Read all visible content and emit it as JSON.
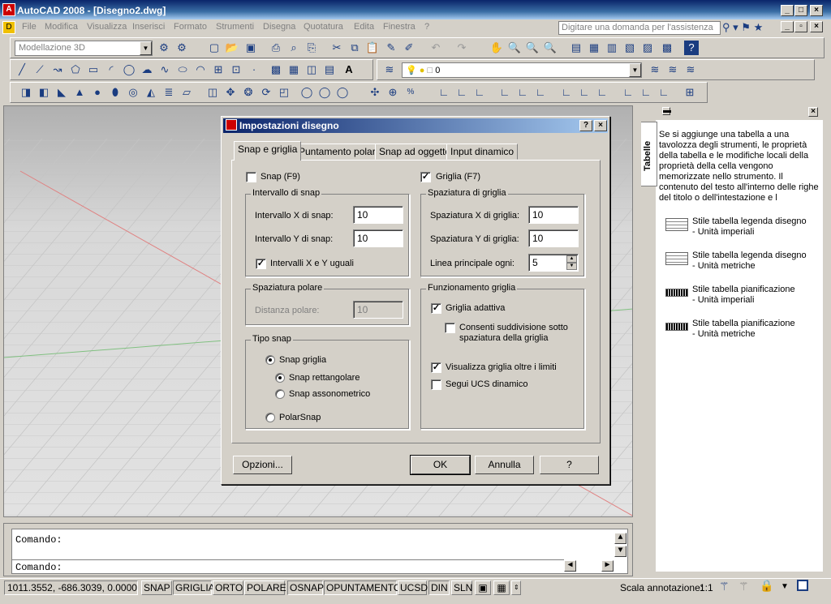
{
  "window": {
    "title": "AutoCAD 2008 - [Disegno2.dwg]"
  },
  "menu": [
    "File",
    "Modifica",
    "Visualizza",
    "Inserisci",
    "Formato",
    "Strumenti",
    "Disegna",
    "Quotatura",
    "Edita",
    "Finestra",
    "?"
  ],
  "help_search_placeholder": "Digitare una domanda per l'assistenza",
  "workspace": "Modellazione 3D",
  "layer_combo": "0",
  "dialog": {
    "title": "Impostazioni disegno",
    "tabs": [
      "Snap e griglia",
      "Puntamento polare",
      "Snap ad oggetto",
      "Input dinamico"
    ],
    "snap_on_label": "Snap (F9)",
    "snap_on": false,
    "grid_on_label": "Griglia (F7)",
    "grid_on": true,
    "snap_spacing": {
      "title": "Intervallo di snap",
      "x_label": "Intervallo X di snap:",
      "x_value": "10",
      "y_label": "Intervallo Y di snap:",
      "y_value": "10",
      "equal_label": "Intervalli X e Y uguali",
      "equal": true
    },
    "polar_spacing": {
      "title": "Spaziatura polare",
      "distance_label": "Distanza polare:",
      "distance_value": "10"
    },
    "snap_type": {
      "title": "Tipo snap",
      "grid_snap": "Snap griglia",
      "rectangular": "Snap rettangolare",
      "isometric": "Snap assonometrico",
      "polar": "PolarSnap"
    },
    "grid_spacing": {
      "title": "Spaziatura di griglia",
      "x_label": "Spaziatura X di griglia:",
      "x_value": "10",
      "y_label": "Spaziatura Y di griglia:",
      "y_value": "10",
      "major_label": "Linea principale ogni:",
      "major_value": "5"
    },
    "grid_behavior": {
      "title": "Funzionamento griglia",
      "adaptive_label": "Griglia adattiva",
      "adaptive": true,
      "subdiv_label": "Consenti suddivisione sotto\nspaziatura della griglia",
      "subdiv": false,
      "beyond_limits_label": "Visualizza griglia oltre i limiti",
      "beyond_limits": true,
      "follow_ucs_label": "Segui UCS dinamico",
      "follow_ucs": false
    },
    "buttons": {
      "options": "Opzioni...",
      "ok": "OK",
      "cancel": "Annulla",
      "help": "?"
    }
  },
  "palette": {
    "tab_label": "Tabelle",
    "description": "Se si aggiunge una tabella a una tavolozza degli strumenti, le proprietà della tabella e le modifiche locali della proprietà della cella vengono memorizzate nello strumento. Il contenuto del testo all'interno delle righe del titolo o dell'intestazione e l",
    "items": [
      "Stile tabella legenda disegno\n- Unità imperiali",
      "Stile tabella legenda disegno\n- Unità metriche",
      "Stile tabella pianificazione\n- Unità imperiali",
      "Stile tabella pianificazione\n- Unità metriche"
    ]
  },
  "command": {
    "line1": "Comando:",
    "line2": "Comando:"
  },
  "status": {
    "coords": "1011.3552, -686.3039, 0.0000",
    "buttons": [
      "SNAP",
      "GRIGLIA",
      "ORTO",
      "POLARE",
      "OSNAP",
      "OPUNTAMENTO",
      "UCSD",
      "DIN",
      "SLN"
    ],
    "annotation_scale_label": "Scala annotazione:",
    "annotation_scale": "1:1"
  }
}
